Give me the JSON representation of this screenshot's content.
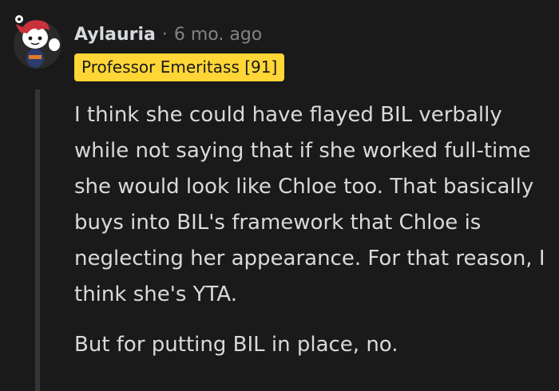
{
  "comment": {
    "author": "Aylauria",
    "separator": "·",
    "age": "6 mo. ago",
    "flair": "Professor Emeritass [91]",
    "paragraphs": [
      "I think she could have flayed BIL verbally while not saying that if she worked full-time she would look like Chloe too. That basically buys into BIL's framework that Chloe is neglecting her appearance. For that reason, I think she's YTA.",
      "But for putting BIL in place, no."
    ]
  },
  "avatar": {
    "icon": "snoo-avatar-icon",
    "hair_color": "#c8323a",
    "body_color": "#2b3c6b"
  },
  "colors": {
    "background": "#1a1a1b",
    "text": "#d7dadc",
    "muted": "#818384",
    "flair_bg": "#ffd635",
    "thread_line": "#343536"
  }
}
